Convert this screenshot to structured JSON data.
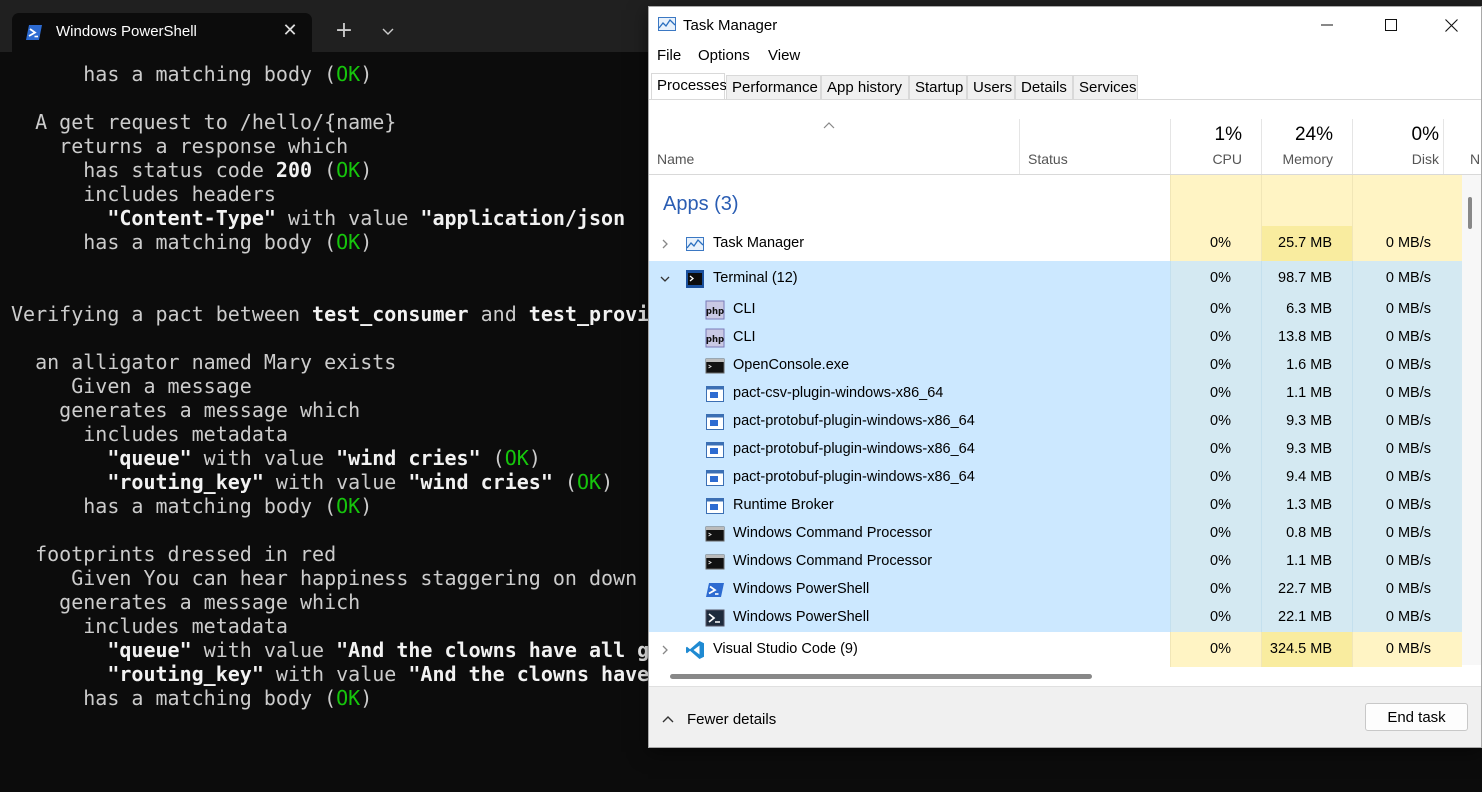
{
  "terminal": {
    "tab_title": "Windows PowerShell",
    "lines": [
      [
        {
          "t": "      has a matching body ("
        },
        {
          "t": "OK",
          "c": "ok"
        },
        {
          "t": ")"
        }
      ],
      [
        {
          "t": ""
        }
      ],
      [
        {
          "t": "  A get request to /hello/{name}"
        }
      ],
      [
        {
          "t": "    returns a response which"
        }
      ],
      [
        {
          "t": "      has status code "
        },
        {
          "t": "200",
          "c": "b"
        },
        {
          "t": " ("
        },
        {
          "t": "OK",
          "c": "ok"
        },
        {
          "t": ")"
        }
      ],
      [
        {
          "t": "      includes headers"
        }
      ],
      [
        {
          "t": "        "
        },
        {
          "t": "\"Content-Type\"",
          "c": "b"
        },
        {
          "t": " with value "
        },
        {
          "t": "\"application/json",
          "c": "b"
        }
      ],
      [
        {
          "t": "      has a matching body ("
        },
        {
          "t": "OK",
          "c": "ok"
        },
        {
          "t": ")"
        }
      ],
      [
        {
          "t": ""
        }
      ],
      [
        {
          "t": ""
        }
      ],
      [
        {
          "t": "Verifying a pact between "
        },
        {
          "t": "test_consumer",
          "c": "b"
        },
        {
          "t": " and "
        },
        {
          "t": "test_provi",
          "c": "b"
        }
      ],
      [
        {
          "t": ""
        }
      ],
      [
        {
          "t": "  an alligator named Mary exists"
        }
      ],
      [
        {
          "t": "     Given a message"
        }
      ],
      [
        {
          "t": "    generates a message which"
        }
      ],
      [
        {
          "t": "      includes metadata"
        }
      ],
      [
        {
          "t": "        "
        },
        {
          "t": "\"queue\"",
          "c": "b"
        },
        {
          "t": " with value "
        },
        {
          "t": "\"wind cries\"",
          "c": "b"
        },
        {
          "t": " ("
        },
        {
          "t": "OK",
          "c": "ok"
        },
        {
          "t": ")"
        }
      ],
      [
        {
          "t": "        "
        },
        {
          "t": "\"routing_key\"",
          "c": "b"
        },
        {
          "t": " with value "
        },
        {
          "t": "\"wind cries\"",
          "c": "b"
        },
        {
          "t": " ("
        },
        {
          "t": "OK",
          "c": "ok"
        },
        {
          "t": ")"
        }
      ],
      [
        {
          "t": "      has a matching body ("
        },
        {
          "t": "OK",
          "c": "ok"
        },
        {
          "t": ")"
        }
      ],
      [
        {
          "t": ""
        }
      ],
      [
        {
          "t": "  footprints dressed in red"
        }
      ],
      [
        {
          "t": "     Given You can hear happiness staggering on down"
        }
      ],
      [
        {
          "t": "    generates a message which"
        }
      ],
      [
        {
          "t": "      includes metadata"
        }
      ],
      [
        {
          "t": "        "
        },
        {
          "t": "\"queue\"",
          "c": "b"
        },
        {
          "t": " with value "
        },
        {
          "t": "\"And the clowns have all g",
          "c": "b"
        }
      ],
      [
        {
          "t": "        "
        },
        {
          "t": "\"routing_key\"",
          "c": "b"
        },
        {
          "t": " with value "
        },
        {
          "t": "\"And the clowns have",
          "c": "b"
        }
      ],
      [
        {
          "t": "      has a matching body ("
        },
        {
          "t": "OK",
          "c": "ok"
        },
        {
          "t": ")"
        }
      ]
    ]
  },
  "taskmanager": {
    "title": "Task Manager",
    "menu": [
      "File",
      "Options",
      "View"
    ],
    "tabs": [
      "Processes",
      "Performance",
      "App history",
      "Startup",
      "Users",
      "Details",
      "Services"
    ],
    "active_tab": "Processes",
    "columns": {
      "name": "Name",
      "status": "Status",
      "cpu": {
        "label": "CPU",
        "pct": "1%"
      },
      "memory": {
        "label": "Memory",
        "pct": "24%"
      },
      "disk": {
        "label": "Disk",
        "pct": "0%"
      },
      "network_partial": "N"
    },
    "group_header": "Apps (3)",
    "rows": [
      {
        "name": "Task Manager",
        "icon": "taskmanager-icon",
        "level": 0,
        "expand": "collapsed",
        "cpu": "0%",
        "memory": "25.7 MB",
        "disk": "0 MB/s",
        "selected": false
      },
      {
        "name": "Terminal (12)",
        "icon": "terminal-icon",
        "level": 0,
        "expand": "expanded",
        "cpu": "0%",
        "memory": "98.7 MB",
        "disk": "0 MB/s",
        "selected": true
      },
      {
        "name": "CLI",
        "icon": "php-icon",
        "level": 1,
        "cpu": "0%",
        "memory": "6.3 MB",
        "disk": "0 MB/s",
        "selected": true
      },
      {
        "name": "CLI",
        "icon": "php-icon",
        "level": 1,
        "cpu": "0%",
        "memory": "13.8 MB",
        "disk": "0 MB/s",
        "selected": true
      },
      {
        "name": "OpenConsole.exe",
        "icon": "console-icon",
        "level": 1,
        "cpu": "0%",
        "memory": "1.6 MB",
        "disk": "0 MB/s",
        "selected": true
      },
      {
        "name": "pact-csv-plugin-windows-x86_64",
        "icon": "app-window-icon",
        "level": 1,
        "cpu": "0%",
        "memory": "1.1 MB",
        "disk": "0 MB/s",
        "selected": true
      },
      {
        "name": "pact-protobuf-plugin-windows-x86_64",
        "icon": "app-window-icon",
        "level": 1,
        "cpu": "0%",
        "memory": "9.3 MB",
        "disk": "0 MB/s",
        "selected": true
      },
      {
        "name": "pact-protobuf-plugin-windows-x86_64",
        "icon": "app-window-icon",
        "level": 1,
        "cpu": "0%",
        "memory": "9.3 MB",
        "disk": "0 MB/s",
        "selected": true
      },
      {
        "name": "pact-protobuf-plugin-windows-x86_64",
        "icon": "app-window-icon",
        "level": 1,
        "cpu": "0%",
        "memory": "9.4 MB",
        "disk": "0 MB/s",
        "selected": true
      },
      {
        "name": "Runtime Broker",
        "icon": "app-window-icon",
        "level": 1,
        "cpu": "0%",
        "memory": "1.3 MB",
        "disk": "0 MB/s",
        "selected": true
      },
      {
        "name": "Windows Command Processor",
        "icon": "console-icon",
        "level": 1,
        "cpu": "0%",
        "memory": "0.8 MB",
        "disk": "0 MB/s",
        "selected": true
      },
      {
        "name": "Windows Command Processor",
        "icon": "console-icon",
        "level": 1,
        "cpu": "0%",
        "memory": "1.1 MB",
        "disk": "0 MB/s",
        "selected": true
      },
      {
        "name": "Windows PowerShell",
        "icon": "powershell-icon",
        "level": 1,
        "cpu": "0%",
        "memory": "22.7 MB",
        "disk": "0 MB/s",
        "selected": true
      },
      {
        "name": "Windows PowerShell",
        "icon": "powershell-dark-icon",
        "level": 1,
        "cpu": "0%",
        "memory": "22.1 MB",
        "disk": "0 MB/s",
        "selected": true
      },
      {
        "name": "Visual Studio Code (9)",
        "icon": "vscode-icon",
        "level": 0,
        "expand": "collapsed",
        "cpu": "0%",
        "memory": "324.5 MB",
        "disk": "0 MB/s",
        "selected": false
      }
    ],
    "footer": {
      "fewer_details": "Fewer details",
      "end_task": "End task"
    },
    "colors": {
      "selection": "#cce8ff",
      "heat_light": "#fff4c4",
      "heat_medium": "#f9ec9f",
      "group_header": "#2a5db3"
    }
  }
}
